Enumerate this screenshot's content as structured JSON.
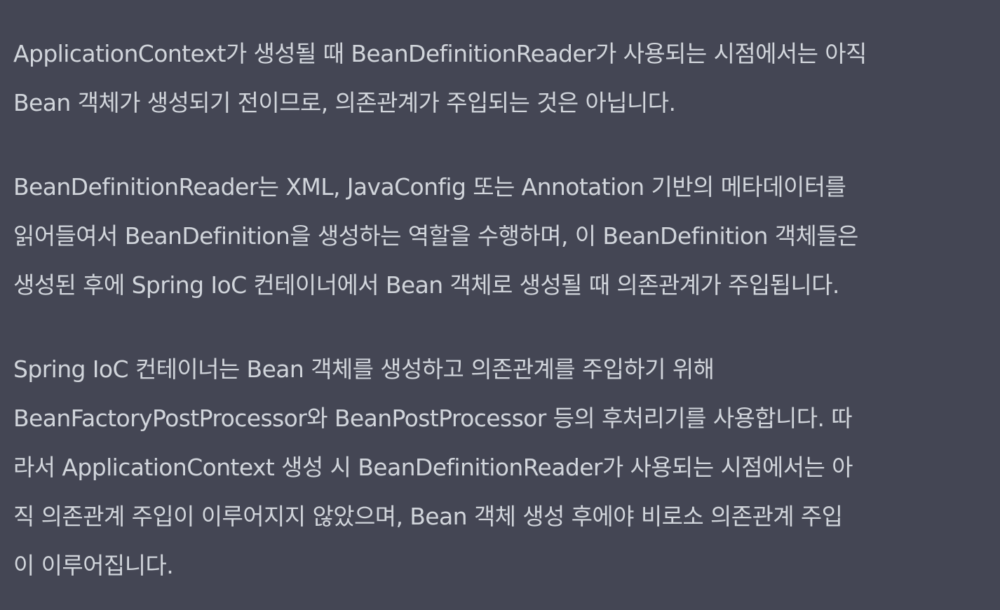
{
  "message": {
    "paragraphs": [
      {
        "lines": [
          "ApplicationContext가 생성될 때 BeanDefinitionReader가 사용되는 시점에서는 아직",
          "Bean 객체가 생성되기 전이므로, 의존관계가 주입되는 것은 아닙니다."
        ]
      },
      {
        "lines": [
          "BeanDefinitionReader는 XML, JavaConfig 또는 Annotation 기반의 메타데이터를",
          "읽어들여서 BeanDefinition을 생성하는 역할을 수행하며, 이 BeanDefinition 객체들은",
          "생성된 후에 Spring IoC 컨테이너에서 Bean 객체로 생성될 때 의존관계가 주입됩니다."
        ]
      },
      {
        "lines": [
          "Spring IoC 컨테이너는 Bean 객체를 생성하고 의존관계를 주입하기 위해",
          "BeanFactoryPostProcessor와 BeanPostProcessor 등의 후처리기를 사용합니다. 따",
          "라서 ApplicationContext 생성 시 BeanDefinitionReader가 사용되는 시점에서는 아",
          "직 의존관계 주입이 이루어지지 않았으며, Bean 객체 생성 후에야 비로소 의존관계 주입",
          "이 이루어집니다."
        ]
      }
    ]
  },
  "colors": {
    "background": "#444654",
    "text": "#d1d5db"
  }
}
